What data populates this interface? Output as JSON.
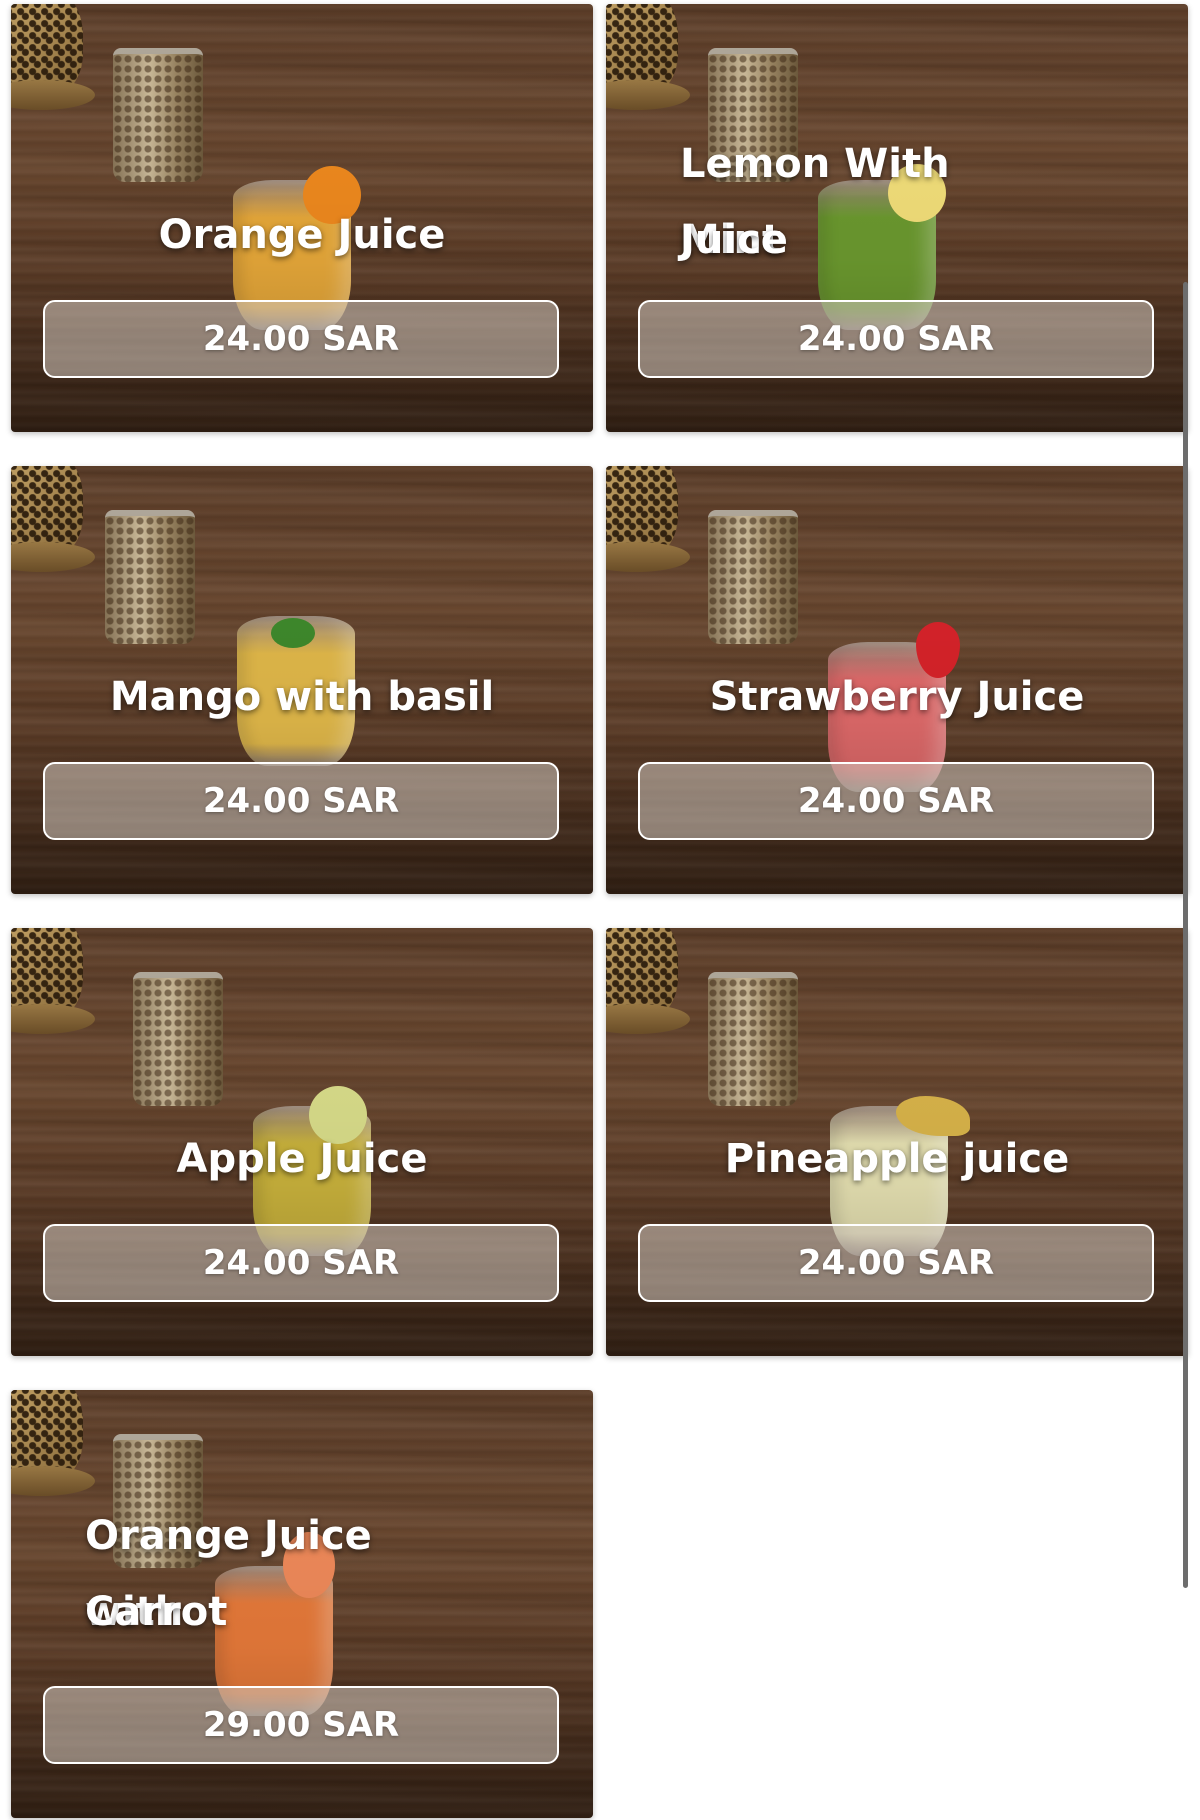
{
  "menu": {
    "items": [
      {
        "name": "Orange Juice",
        "price": "24.00 SAR",
        "glass_color": "#e8a93a",
        "garnish_color": "#f08a1e"
      },
      {
        "name": "Lemon With Mint Juice",
        "name_line1": "Lemon With Mint",
        "name_line2": "Juice",
        "price": "24.00 SAR",
        "glass_color": "#6c9a2f",
        "garnish_color": "#f4e07a"
      },
      {
        "name": "Mango with basil",
        "price": "24.00 SAR",
        "glass_color": "#e2b94a",
        "garnish_color": "#3f8a2c"
      },
      {
        "name": "Strawberry Juice",
        "price": "24.00 SAR",
        "glass_color": "#e06a6a",
        "garnish_color": "#d8232a"
      },
      {
        "name": "Apple Juice",
        "price": "24.00 SAR",
        "glass_color": "#c9b23c",
        "garnish_color": "#d9dd8a"
      },
      {
        "name": "Pineapple juice",
        "price": "24.00 SAR",
        "glass_color": "#e6e1b2",
        "garnish_color": "#d9b44a"
      },
      {
        "name": "Orange Juice with Carrot",
        "name_line1": "Orange Juice with",
        "name_line2": "Carrot",
        "price": "29.00 SAR",
        "glass_color": "#e77a3a",
        "garnish_color": "#f08a5a"
      }
    ]
  }
}
